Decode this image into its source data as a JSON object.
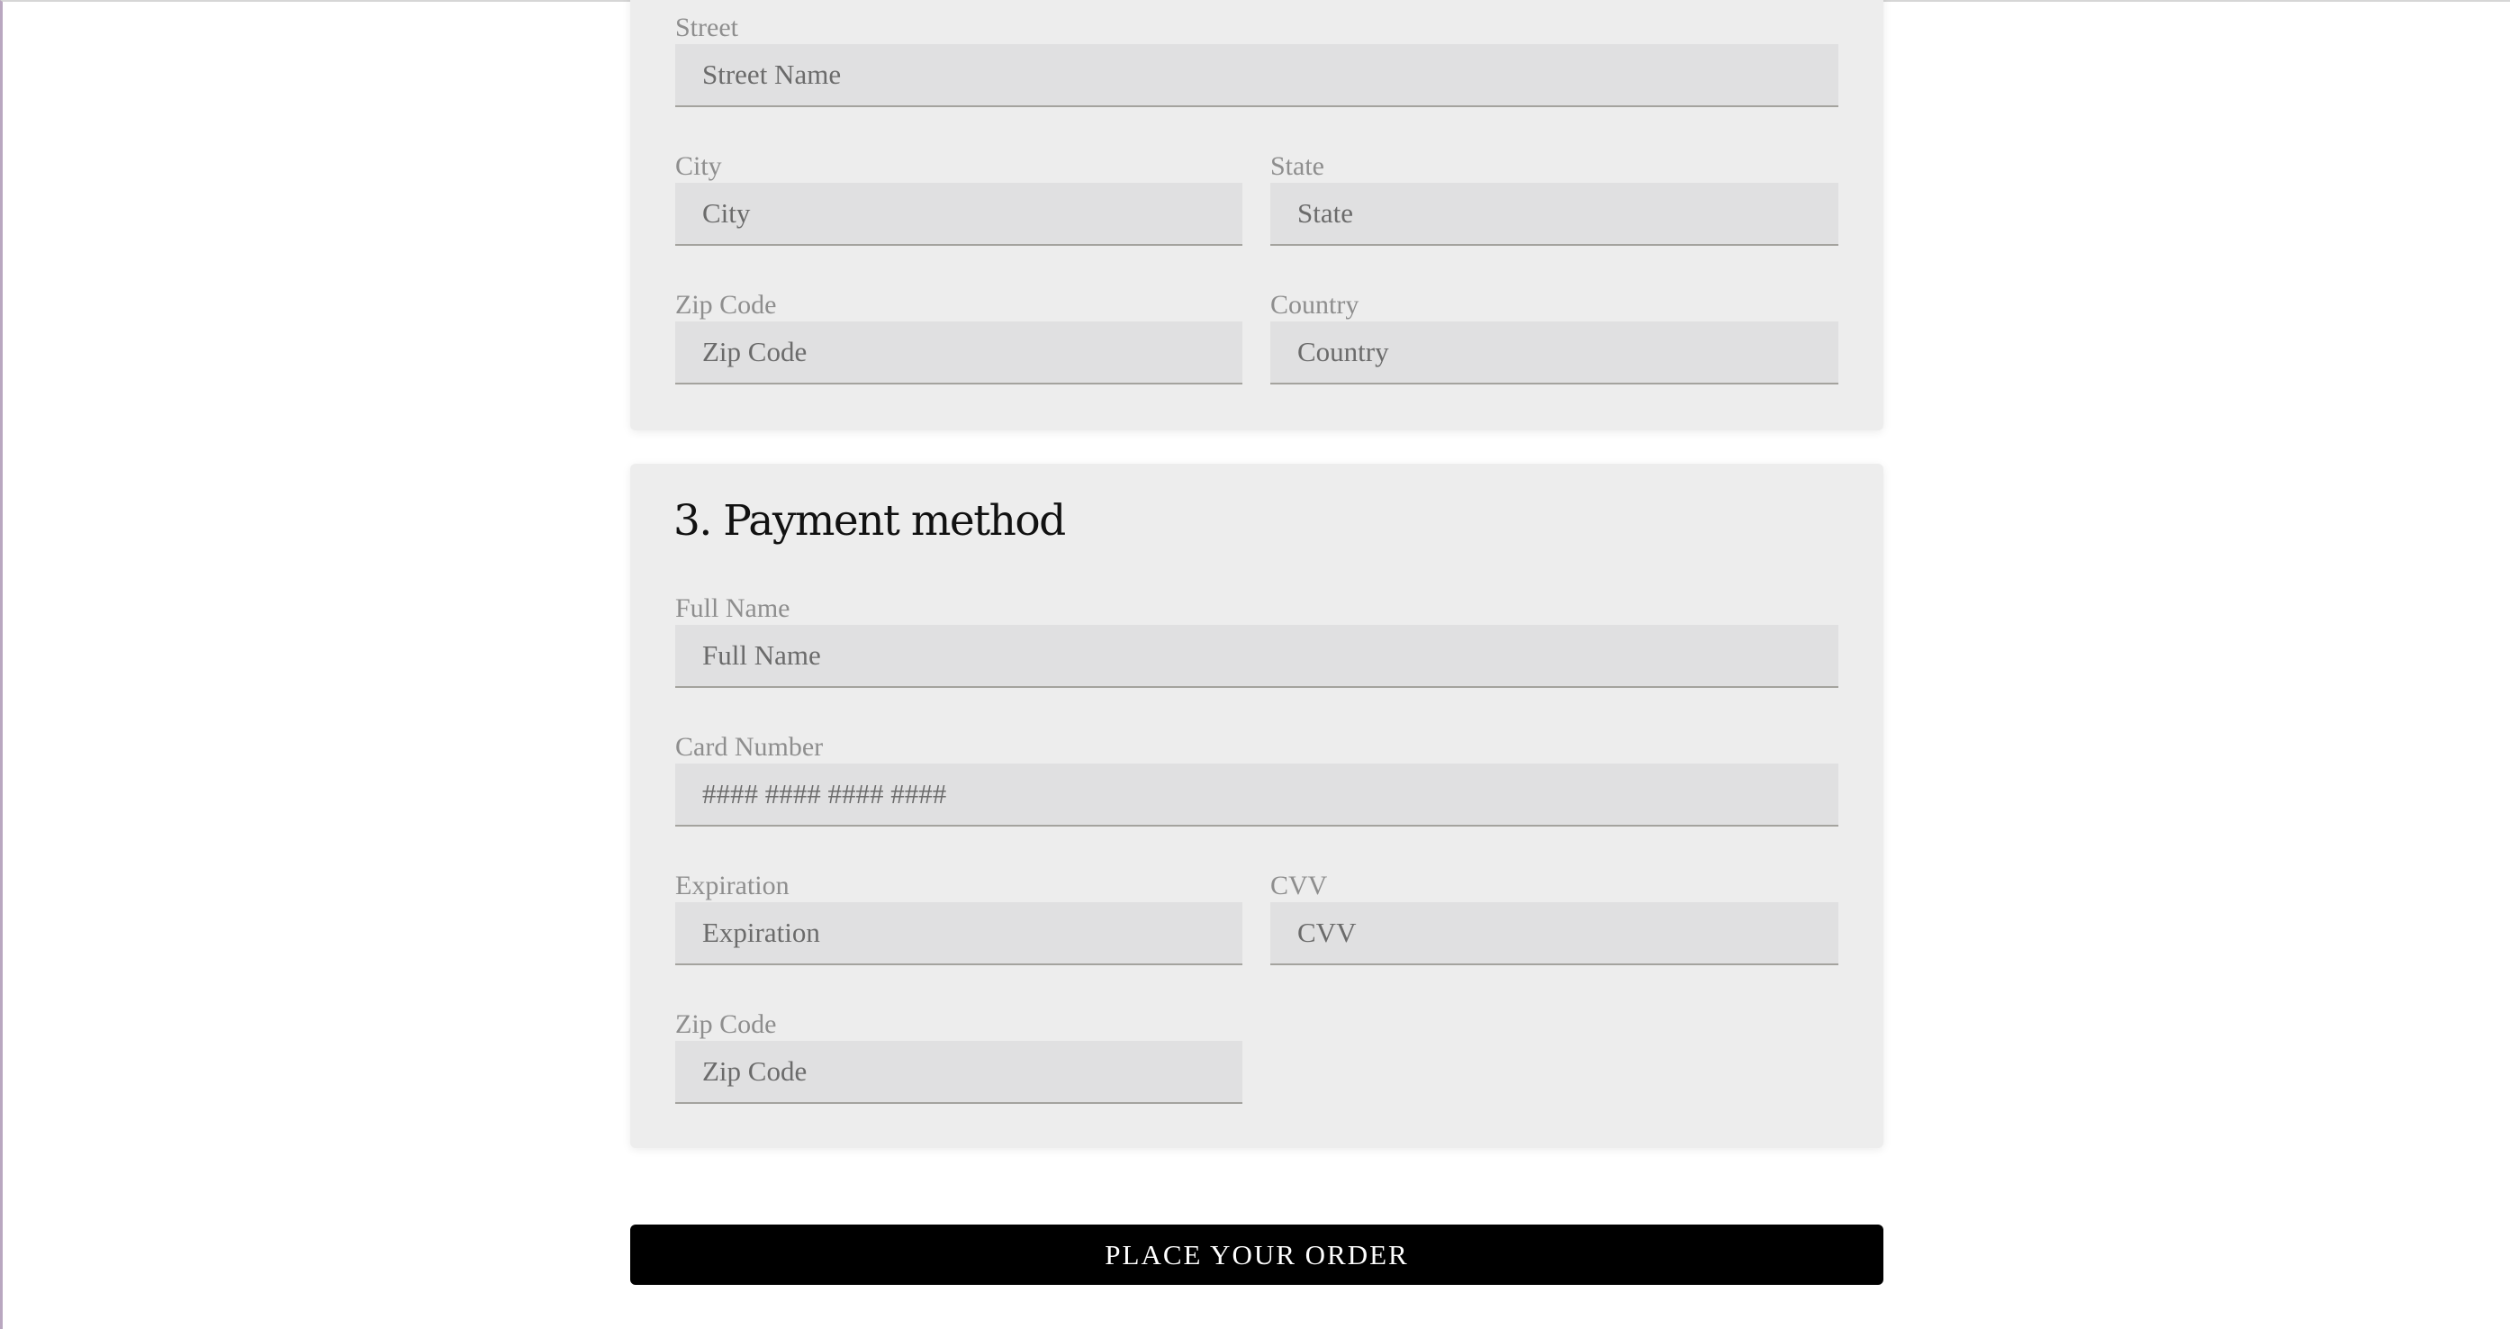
{
  "address_section": {
    "street": {
      "label": "Street",
      "placeholder": "Street Name"
    },
    "city": {
      "label": "City",
      "placeholder": "City"
    },
    "state": {
      "label": "State",
      "placeholder": "State"
    },
    "zip": {
      "label": "Zip Code",
      "placeholder": "Zip Code"
    },
    "country": {
      "label": "Country",
      "placeholder": "Country"
    }
  },
  "payment_section": {
    "title": "3. Payment method",
    "full_name": {
      "label": "Full Name",
      "placeholder": "Full Name"
    },
    "card_number": {
      "label": "Card Number",
      "placeholder": "#### #### #### ####"
    },
    "expiration": {
      "label": "Expiration",
      "placeholder": "Expiration"
    },
    "cvv": {
      "label": "CVV",
      "placeholder": "CVV"
    },
    "zip": {
      "label": "Zip Code",
      "placeholder": "Zip Code"
    }
  },
  "order_button": {
    "label": "PLACE YOUR ORDER"
  },
  "colors": {
    "card_background": "#ededed",
    "input_background": "#e0e0e1",
    "button_background": "#000000"
  }
}
